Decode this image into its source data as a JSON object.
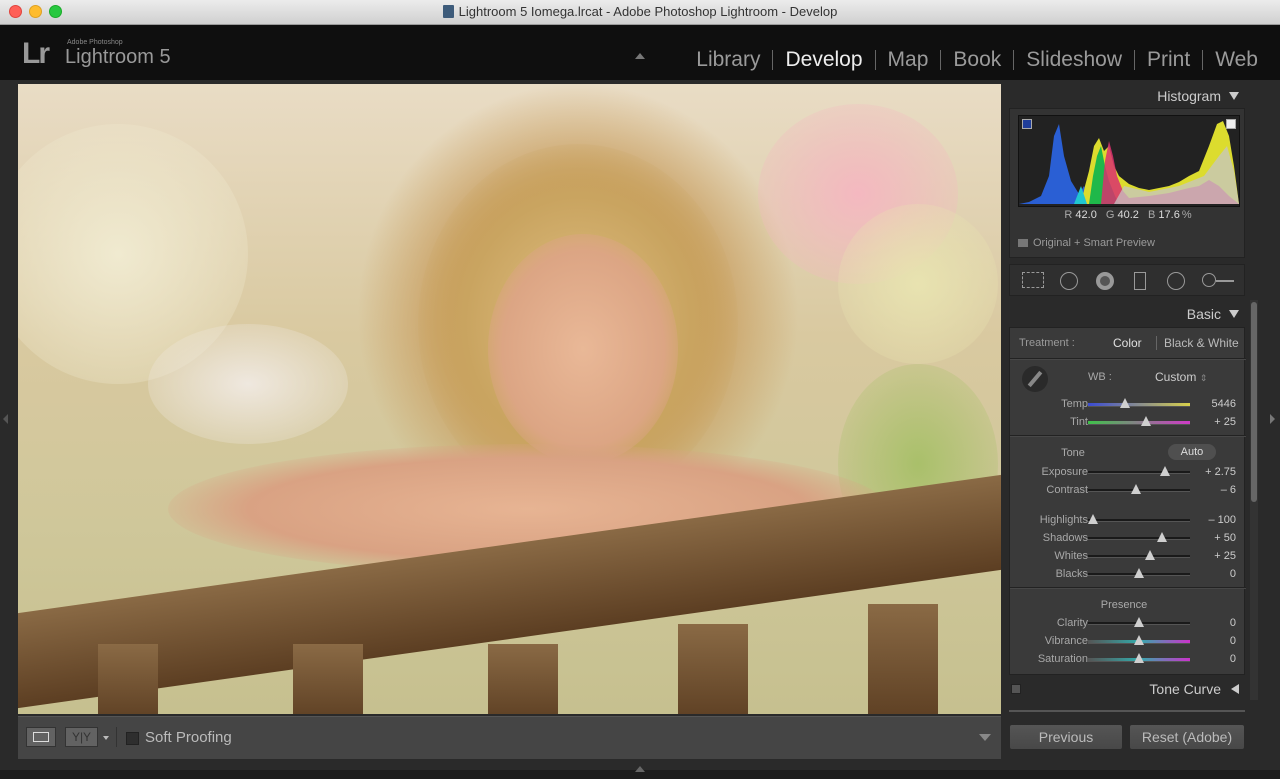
{
  "window": {
    "title": "Lightroom 5 Iomega.lrcat - Adobe Photoshop Lightroom - Develop"
  },
  "brand": {
    "small": "Adobe Photoshop",
    "name": "Lightroom 5",
    "logo": "Lr"
  },
  "modules": [
    {
      "label": "Library",
      "active": false
    },
    {
      "label": "Develop",
      "active": true
    },
    {
      "label": "Map",
      "active": false
    },
    {
      "label": "Book",
      "active": false
    },
    {
      "label": "Slideshow",
      "active": false
    },
    {
      "label": "Print",
      "active": false
    },
    {
      "label": "Web",
      "active": false
    }
  ],
  "toolbar": {
    "soft_proofing": "Soft Proofing"
  },
  "histogram": {
    "title": "Histogram",
    "r_label": "R",
    "r": "42.0",
    "g_label": "G",
    "g": "40.2",
    "b_label": "B",
    "b": "17.6",
    "unit": "%",
    "preview": "Original + Smart Preview"
  },
  "basic": {
    "title": "Basic",
    "treatment_label": "Treatment :",
    "color": "Color",
    "bw": "Black & White",
    "wb_label": "WB :",
    "wb_value": "Custom",
    "tone_label": "Tone",
    "auto": "Auto",
    "presence_label": "Presence",
    "sliders": [
      {
        "name": "Temp",
        "value": "5446",
        "pos": 0.36
      },
      {
        "name": "Tint",
        "value": "+ 25",
        "pos": 0.57
      },
      {
        "name": "Exposure",
        "value": "+ 2.75",
        "pos": 0.75
      },
      {
        "name": "Contrast",
        "value": "– 6",
        "pos": 0.47
      },
      {
        "name": "Highlights",
        "value": "– 100",
        "pos": 0.05
      },
      {
        "name": "Shadows",
        "value": "+ 50",
        "pos": 0.73
      },
      {
        "name": "Whites",
        "value": "+ 25",
        "pos": 0.61
      },
      {
        "name": "Blacks",
        "value": "0",
        "pos": 0.5
      },
      {
        "name": "Clarity",
        "value": "0",
        "pos": 0.5
      },
      {
        "name": "Vibrance",
        "value": "0",
        "pos": 0.5
      },
      {
        "name": "Saturation",
        "value": "0",
        "pos": 0.5
      }
    ]
  },
  "tone_curve": {
    "title": "Tone Curve"
  },
  "buttons": {
    "previous": "Previous",
    "reset": "Reset (Adobe)"
  }
}
